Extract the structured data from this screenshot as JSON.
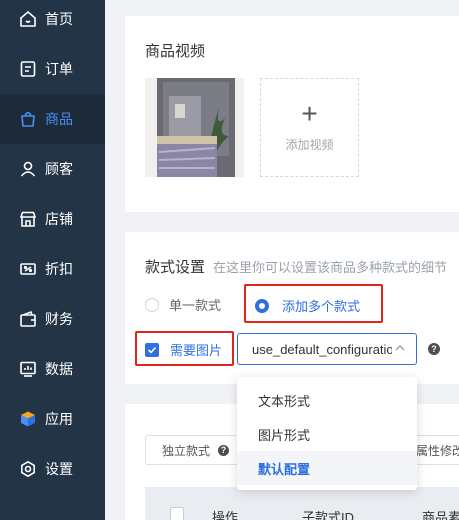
{
  "sidebar": {
    "items": [
      {
        "label": "首页",
        "icon": "home-icon"
      },
      {
        "label": "订单",
        "icon": "order-icon"
      },
      {
        "label": "商品",
        "icon": "product-bag-icon",
        "active": true
      },
      {
        "label": "顾客",
        "icon": "customer-icon"
      },
      {
        "label": "店铺",
        "icon": "store-icon"
      },
      {
        "label": "折扣",
        "icon": "discount-icon"
      },
      {
        "label": "财务",
        "icon": "finance-icon"
      },
      {
        "label": "数据",
        "icon": "data-icon"
      },
      {
        "label": "应用",
        "icon": "app-cube-icon"
      },
      {
        "label": "设置",
        "icon": "settings-icon"
      }
    ]
  },
  "video_section": {
    "title": "商品视频",
    "add_label": "添加视频"
  },
  "style_section": {
    "title": "款式设置",
    "subtitle": "在这里你可以设置该商品多种款式的细节",
    "single_option": "单一款式",
    "multi_option": "添加多个款式",
    "need_image": "需要图片",
    "select_value": "use_default_configuration",
    "dropdown_options": [
      "文本形式",
      "图片形式",
      "默认配置"
    ],
    "selected_option": "默认配置"
  },
  "variants": {
    "independent_label": "独立款式",
    "attr_label": "属性修改",
    "columns": [
      "操作",
      "子款式ID",
      "商品素"
    ]
  },
  "colors": {
    "sidebar_bg": "#243447",
    "accent": "#2f6fe0",
    "highlight_border": "#e1251b"
  }
}
